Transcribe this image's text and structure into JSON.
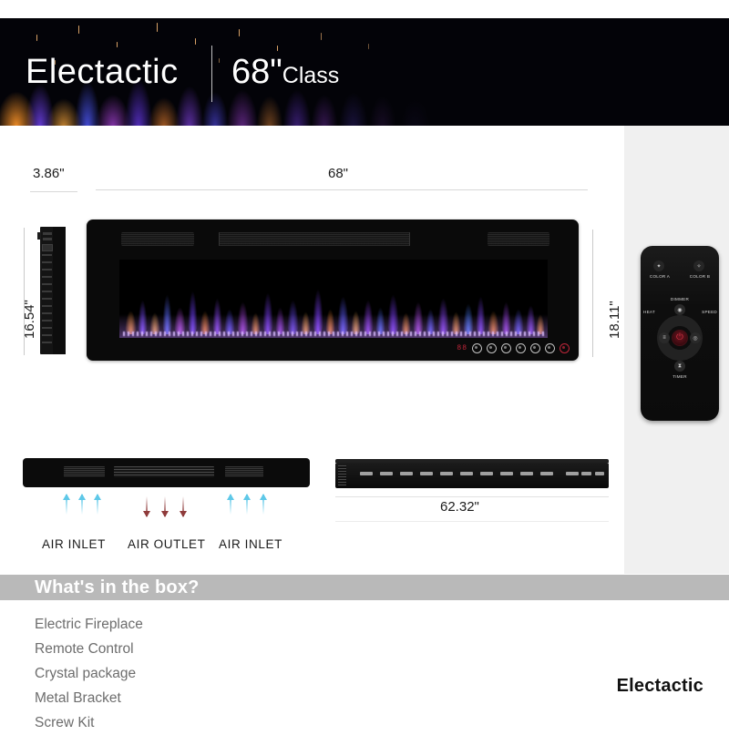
{
  "header": {
    "brand": "Electactic",
    "size_label": "68\"",
    "class_label": "Class"
  },
  "dimensions": {
    "depth": "3.86\"",
    "width": "68\"",
    "height_side": "16.54\"",
    "height_front": "18.11\"",
    "recess_width": "62.32\""
  },
  "fireplace": {
    "control_display": "88",
    "control_icons": [
      "mode-icon",
      "flame-color-icon",
      "brightness-icon",
      "speed-icon",
      "heat-icon",
      "timer-icon"
    ],
    "power_icon": "power-icon"
  },
  "airflow": {
    "inlet_left": "AIR INLET",
    "outlet": "AIR OUTLET",
    "inlet_right": "AIR INLET",
    "inlet_color": "#5ec8e8",
    "outlet_color": "#8f3b3b"
  },
  "remote": {
    "color_a": "COLOR A",
    "color_b": "COLOR B",
    "dimmer": "DIMMER",
    "heat": "HEAT",
    "speed": "SPEED",
    "timer": "TIMER",
    "power_icon": "power-icon",
    "color_a_icon": "palette-icon",
    "color_b_icon": "palette-icon",
    "dimmer_icon": "droplet-flame-icon",
    "timer_icon": "hourglass-icon",
    "left_icon": "flame-icon",
    "right_icon": "flame-swirl-icon"
  },
  "whats_in_box": {
    "title": "What's in the box?",
    "items": [
      "Electric Fireplace",
      "Remote Control",
      "Crystal package",
      "Metal Bracket",
      "Screw Kit"
    ]
  },
  "footer": {
    "brand": "Electactic"
  }
}
